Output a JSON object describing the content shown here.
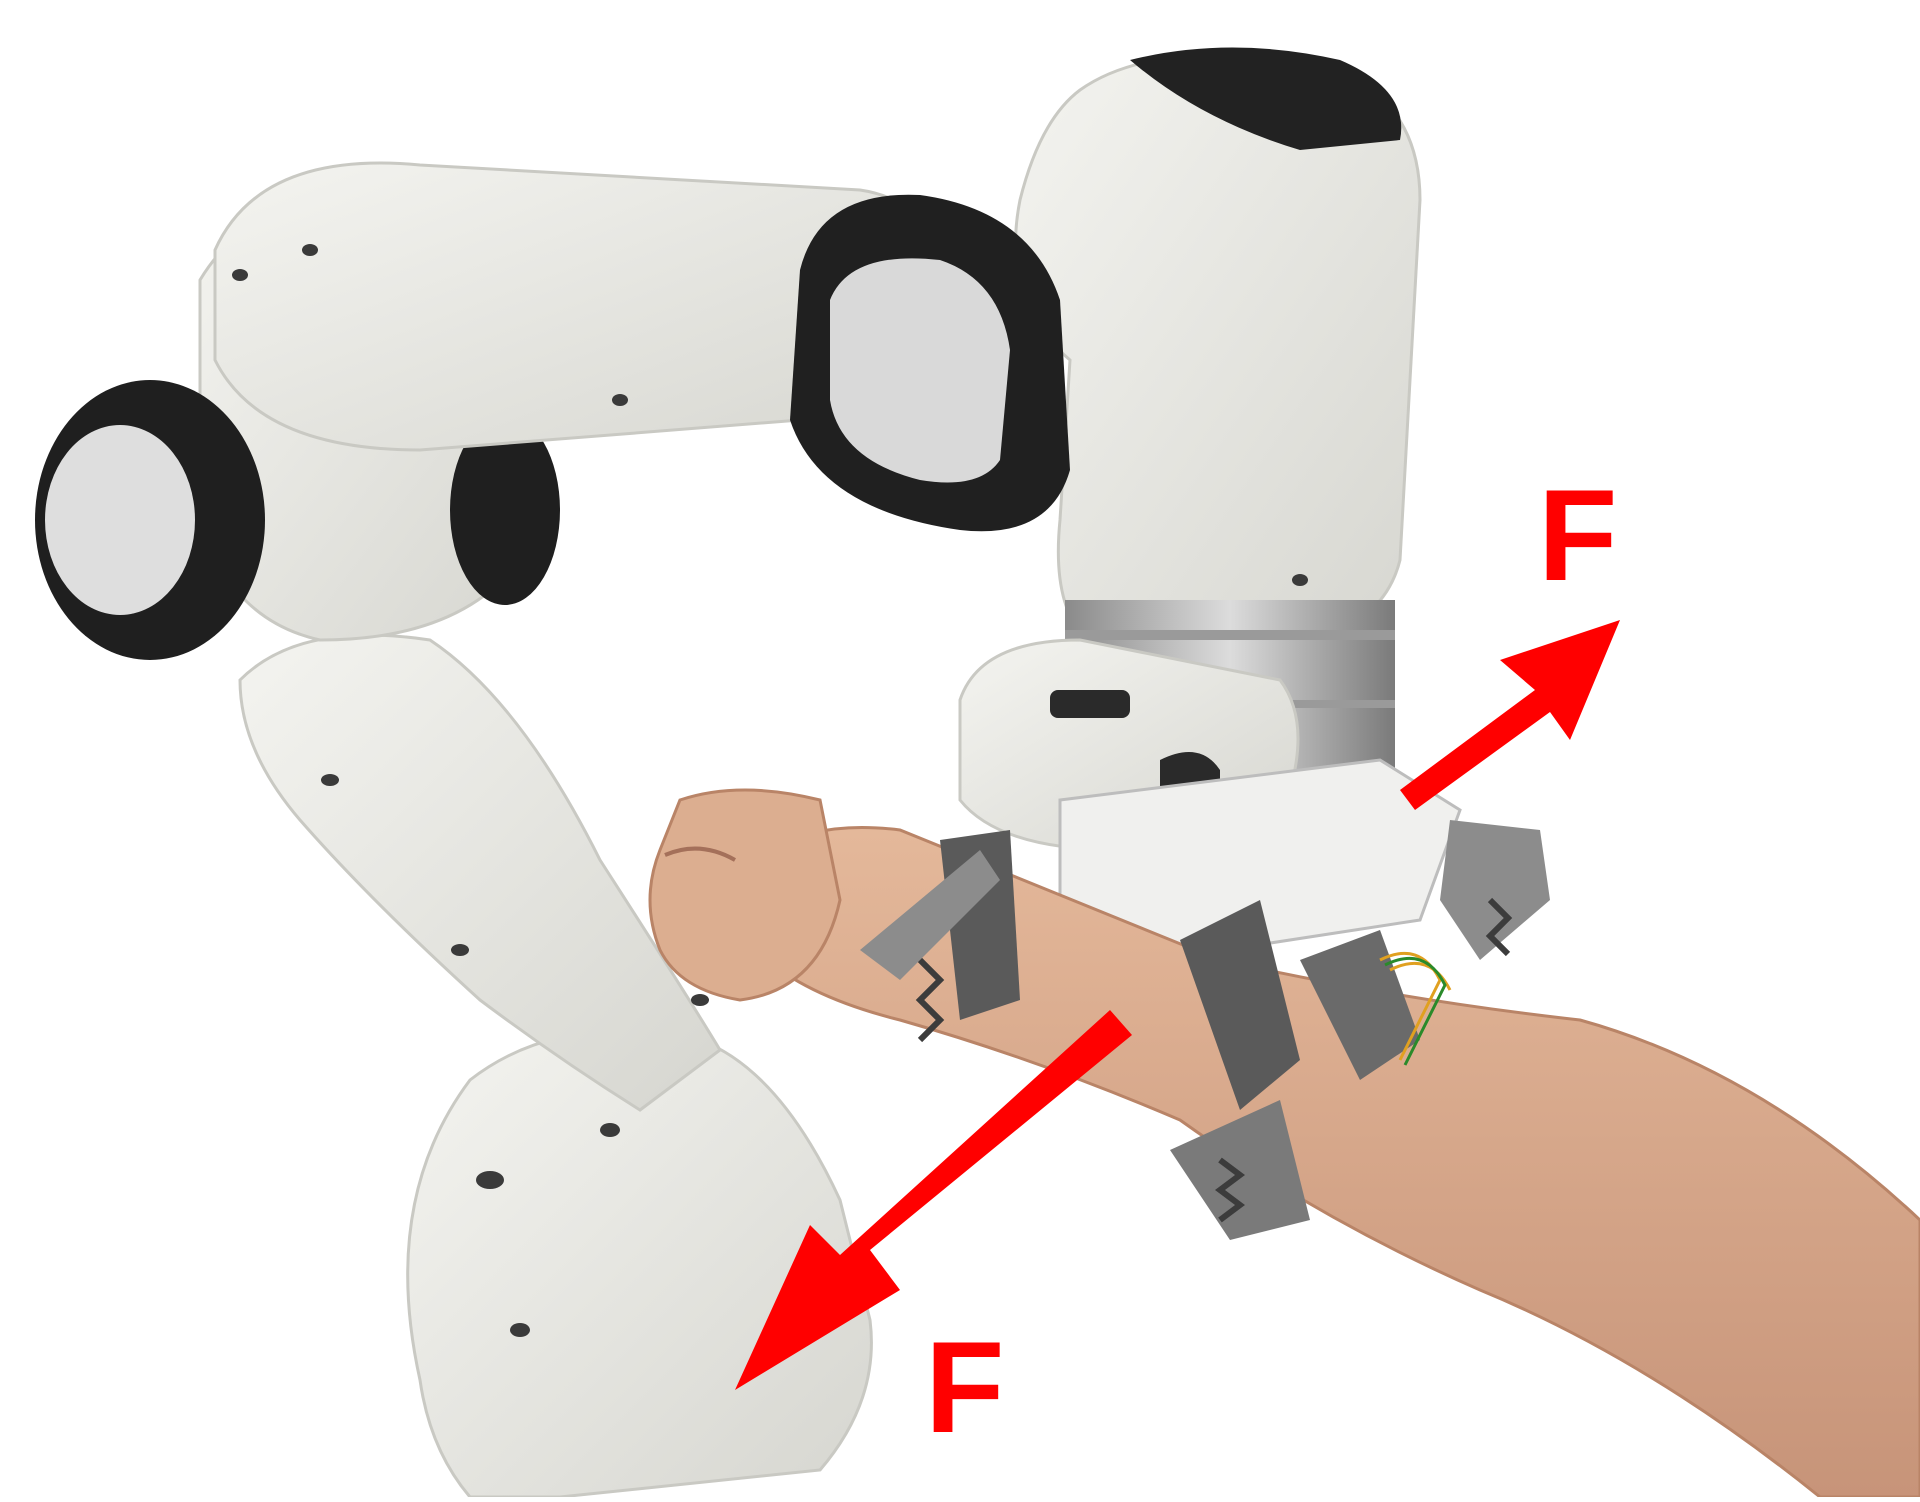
{
  "image": {
    "description_free": true
  },
  "annotations": {
    "force_label_top": "F",
    "force_label_bottom": "F"
  },
  "colors": {
    "arrow": "#ff0000",
    "robot_body": "#e9e9e4",
    "robot_dark": "#2b2b2b",
    "skin": "#d9a98a",
    "led": "#3fa0ff",
    "metal": "#bdbdbd"
  },
  "icons": [
    "force-arrow-icon"
  ]
}
